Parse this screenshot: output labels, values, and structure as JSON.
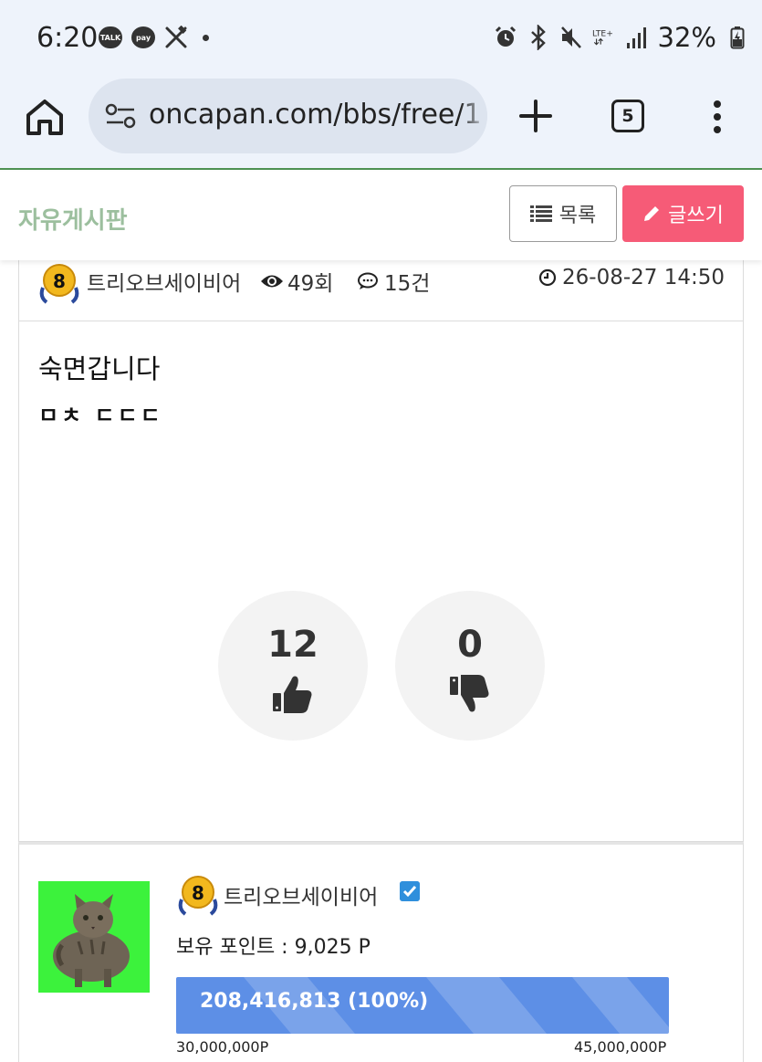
{
  "status_bar": {
    "time": "6:20",
    "notifications": [
      "TALK",
      "pay"
    ],
    "network": "LTE+",
    "battery": "32%"
  },
  "browser": {
    "url": "oncapan.com/bbs/free/1",
    "tab_count": "5"
  },
  "board": {
    "title": "자유게시판",
    "list_label": "목록",
    "write_label": "글쓰기",
    "write_button_color": "#f65b77",
    "title_color": "#9cbf9e"
  },
  "post": {
    "level": "8",
    "author": "트리오브세이비어",
    "views": "49회",
    "comments": "15건",
    "date": "26-08-27 14:50",
    "title": "숙면갑니다",
    "body": "ㅁㅊ ㄷㄷㄷ",
    "likes": "12",
    "dislikes": "0"
  },
  "profile": {
    "level": "8",
    "name": "트리오브세이비어",
    "points_label": "보유 포인트 : 9,025 P",
    "exp_text": "208,416,813 (100%)",
    "exp_fill": 1.0,
    "exp_min": "30,000,000P",
    "exp_max": "45,000,000P",
    "exp_bar_color": "#5d8fe6"
  }
}
